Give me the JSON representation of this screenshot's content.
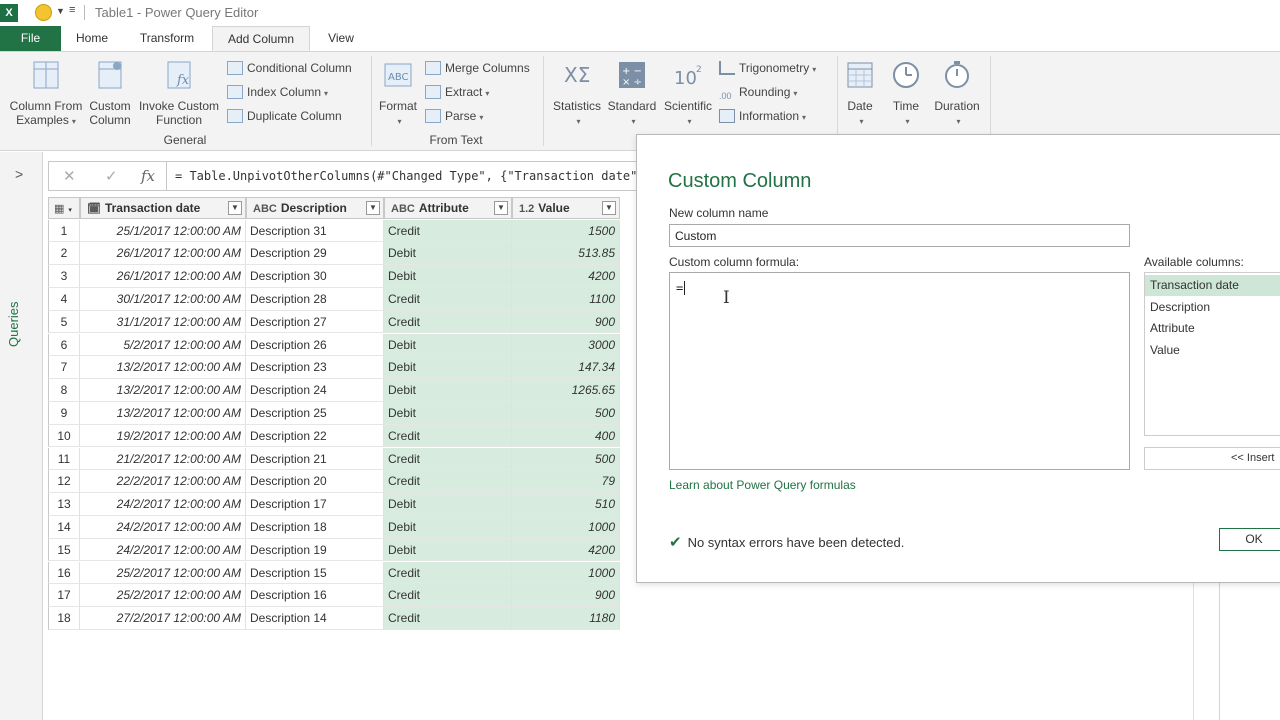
{
  "titlebar": {
    "app_icon": "X",
    "window_title": "Table1 - Power Query Editor"
  },
  "tabs": [
    "File",
    "Home",
    "Transform",
    "Add Column",
    "View"
  ],
  "ribbon": {
    "general": {
      "column_from_examples": [
        "Column From",
        "Examples"
      ],
      "custom_column": [
        "Custom",
        "Column"
      ],
      "invoke_custom_function": [
        "Invoke Custom",
        "Function"
      ],
      "conditional_column": "Conditional Column",
      "index_column": "Index Column",
      "duplicate_column": "Duplicate Column",
      "label": "General"
    },
    "from_text": {
      "format": "Format",
      "merge_columns": "Merge Columns",
      "extract": "Extract",
      "parse": "Parse",
      "label": "From Text"
    },
    "from_number": {
      "statistics": "Statistics",
      "standard": "Standard",
      "scientific": "Scientific",
      "trigonometry": "Trigonometry",
      "rounding": "Rounding",
      "information": "Information"
    },
    "from_date_time": {
      "date": "Date",
      "time": "Time",
      "duration": "Duration"
    }
  },
  "queries_pane": {
    "label": "Queries"
  },
  "formula_bar": {
    "formula": "= Table.UnpivotOtherColumns(#\"Changed Type\", {\"Transaction date\""
  },
  "table": {
    "headers": [
      {
        "type": "",
        "name": "Transaction date"
      },
      {
        "type": "ABC",
        "name": "Description"
      },
      {
        "type": "ABC",
        "name": "Attribute"
      },
      {
        "type": "1.2",
        "name": "Value"
      }
    ],
    "rows": [
      {
        "n": "1",
        "date": "25/1/2017 12:00:00 AM",
        "desc": "Description 31",
        "attr": "Credit",
        "value": "1500"
      },
      {
        "n": "2",
        "date": "26/1/2017 12:00:00 AM",
        "desc": "Description 29",
        "attr": "Debit",
        "value": "513.85"
      },
      {
        "n": "3",
        "date": "26/1/2017 12:00:00 AM",
        "desc": "Description 30",
        "attr": "Debit",
        "value": "4200"
      },
      {
        "n": "4",
        "date": "30/1/2017 12:00:00 AM",
        "desc": "Description 28",
        "attr": "Credit",
        "value": "1100"
      },
      {
        "n": "5",
        "date": "31/1/2017 12:00:00 AM",
        "desc": "Description 27",
        "attr": "Credit",
        "value": "900"
      },
      {
        "n": "6",
        "date": "5/2/2017 12:00:00 AM",
        "desc": "Description 26",
        "attr": "Debit",
        "value": "3000"
      },
      {
        "n": "7",
        "date": "13/2/2017 12:00:00 AM",
        "desc": "Description 23",
        "attr": "Debit",
        "value": "147.34"
      },
      {
        "n": "8",
        "date": "13/2/2017 12:00:00 AM",
        "desc": "Description 24",
        "attr": "Debit",
        "value": "1265.65"
      },
      {
        "n": "9",
        "date": "13/2/2017 12:00:00 AM",
        "desc": "Description 25",
        "attr": "Debit",
        "value": "500"
      },
      {
        "n": "10",
        "date": "19/2/2017 12:00:00 AM",
        "desc": "Description 22",
        "attr": "Credit",
        "value": "400"
      },
      {
        "n": "11",
        "date": "21/2/2017 12:00:00 AM",
        "desc": "Description 21",
        "attr": "Credit",
        "value": "500"
      },
      {
        "n": "12",
        "date": "22/2/2017 12:00:00 AM",
        "desc": "Description 20",
        "attr": "Credit",
        "value": "79"
      },
      {
        "n": "13",
        "date": "24/2/2017 12:00:00 AM",
        "desc": "Description 17",
        "attr": "Debit",
        "value": "510"
      },
      {
        "n": "14",
        "date": "24/2/2017 12:00:00 AM",
        "desc": "Description 18",
        "attr": "Debit",
        "value": "1000"
      },
      {
        "n": "15",
        "date": "24/2/2017 12:00:00 AM",
        "desc": "Description 19",
        "attr": "Debit",
        "value": "4200"
      },
      {
        "n": "16",
        "date": "25/2/2017 12:00:00 AM",
        "desc": "Description 15",
        "attr": "Credit",
        "value": "1000"
      },
      {
        "n": "17",
        "date": "25/2/2017 12:00:00 AM",
        "desc": "Description 16",
        "attr": "Credit",
        "value": "900"
      },
      {
        "n": "18",
        "date": "27/2/2017 12:00:00 AM",
        "desc": "Description 14",
        "attr": "Credit",
        "value": "1180"
      }
    ]
  },
  "dialog": {
    "title": "Custom Column",
    "name_label": "New column name",
    "name_value": "Custom",
    "formula_label": "Custom column formula:",
    "formula_value": "=",
    "available_label": "Available columns:",
    "available_columns": [
      "Transaction date",
      "Description",
      "Attribute",
      "Value"
    ],
    "insert_label": "<< Insert",
    "learn_link": "Learn about Power Query formulas",
    "status": "No syntax errors have been detected.",
    "ok_label": "OK"
  },
  "colors": {
    "excel_green": "#217346",
    "highlight": "#d7ecdf"
  }
}
